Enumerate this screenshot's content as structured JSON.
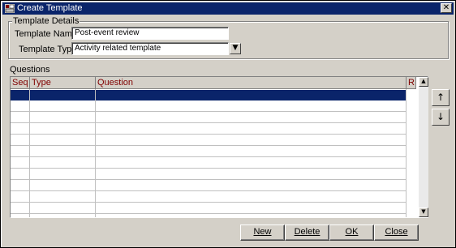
{
  "window": {
    "title": "Create Template",
    "close_glyph": "✕"
  },
  "template_details": {
    "legend": "Template Details",
    "name_label": "Template Name",
    "name_value": "Post-event review",
    "type_label": "Template Type",
    "type_value": "Activity related template",
    "dropdown_glyph": "▼"
  },
  "questions": {
    "label": "Questions",
    "columns": [
      "Seq",
      "Type",
      "Question",
      "R"
    ],
    "rows": [
      {
        "seq": "",
        "type": "",
        "question": "",
        "r": "",
        "selected": true
      },
      {
        "seq": "",
        "type": "",
        "question": "",
        "r": ""
      },
      {
        "seq": "",
        "type": "",
        "question": "",
        "r": ""
      },
      {
        "seq": "",
        "type": "",
        "question": "",
        "r": ""
      },
      {
        "seq": "",
        "type": "",
        "question": "",
        "r": ""
      },
      {
        "seq": "",
        "type": "",
        "question": "",
        "r": ""
      },
      {
        "seq": "",
        "type": "",
        "question": "",
        "r": ""
      },
      {
        "seq": "",
        "type": "",
        "question": "",
        "r": ""
      },
      {
        "seq": "",
        "type": "",
        "question": "",
        "r": ""
      },
      {
        "seq": "",
        "type": "",
        "question": "",
        "r": ""
      },
      {
        "seq": "",
        "type": "",
        "question": "",
        "r": ""
      }
    ],
    "scroll_up_glyph": "▲",
    "scroll_down_glyph": "▼",
    "move_up_glyph": "↑",
    "move_down_glyph": "↓"
  },
  "buttons": {
    "new": "New",
    "delete": "Delete",
    "ok": "OK",
    "close": "Close"
  },
  "colors": {
    "titlebar": "#0a246a",
    "selection": "#0a246a",
    "header_text": "#800000",
    "face": "#d4d0c8"
  }
}
